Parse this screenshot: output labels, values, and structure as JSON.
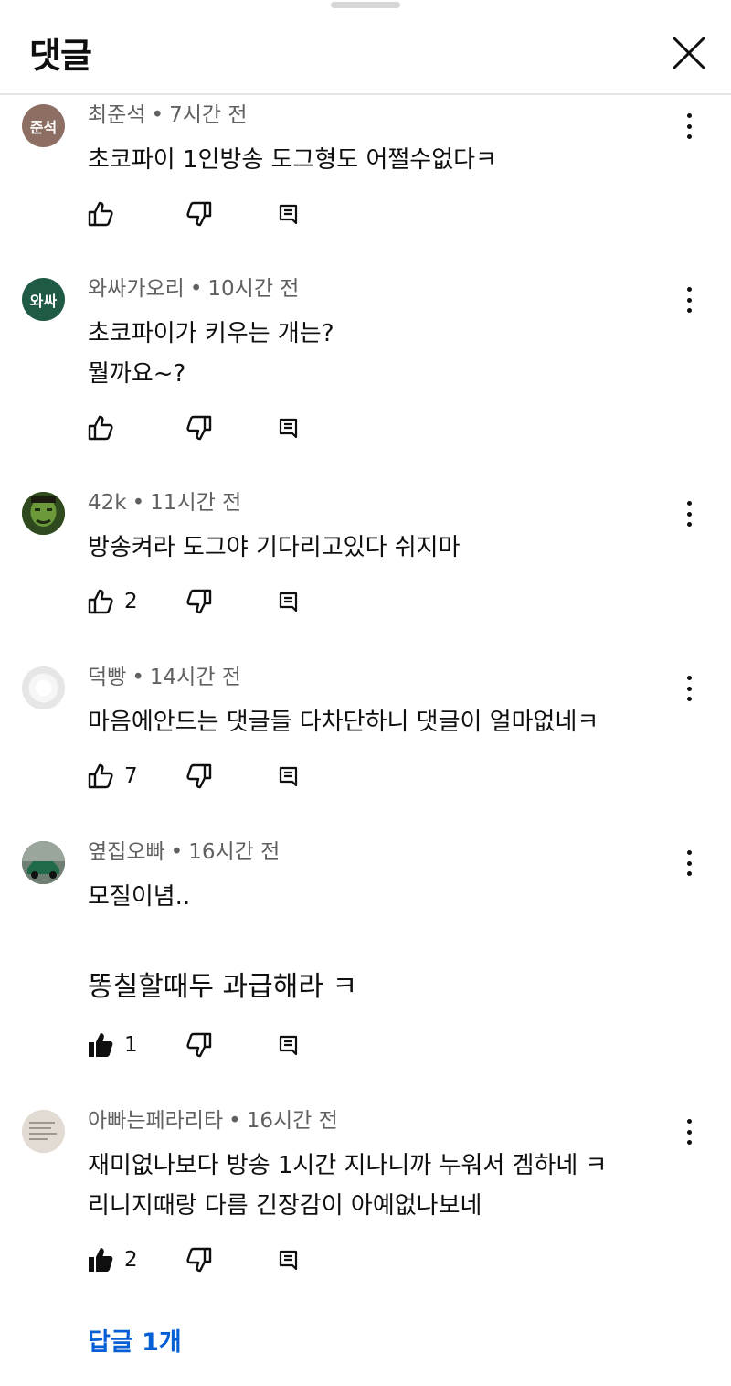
{
  "header": {
    "title": "댓글"
  },
  "comments": [
    {
      "avatar_text": "준석",
      "avatar_color": "#8d6e63",
      "author": "최준석",
      "time": "7시간 전",
      "lines": [
        "초코파이 1인방송 도그형도 어쩔수없다ㅋ"
      ],
      "likes": "",
      "liked": false
    },
    {
      "avatar_text": "와싸",
      "avatar_color": "#1f5a45",
      "author": "와싸가오리",
      "time": "10시간 전",
      "lines": [
        "초코파이가 키우는 개는?",
        "뭘까요~?"
      ],
      "likes": "",
      "liked": false
    },
    {
      "avatar_text": "",
      "avatar_color": "#4e7a2e",
      "author": "42k",
      "time": "11시간 전",
      "lines": [
        "방송켜라 도그야 기다리고있다 쉬지마"
      ],
      "likes": "2",
      "liked": false
    },
    {
      "avatar_text": "",
      "avatar_color": "#e4e4e4",
      "author": "덕빵",
      "time": "14시간 전",
      "lines": [
        "마음에안드는 댓글들 다차단하니 댓글이 얼마없네ㅋ"
      ],
      "likes": "7",
      "liked": false
    },
    {
      "avatar_text": "",
      "avatar_color": "#3f5b4a",
      "author": "옆집오빠",
      "time": "16시간 전",
      "lines": [
        "모질이념..",
        "똥칠할때두 과급해라 ㅋ"
      ],
      "likes": "1",
      "liked": true
    },
    {
      "avatar_text": "",
      "avatar_color": "#ddd6cf",
      "author": "아빠는페라리타",
      "time": "16시간 전",
      "lines": [
        "재미없나보다 방송 1시간 지나니까 누워서 겜하네 ㅋ",
        "리니지때랑 다름 긴장감이 아예없나보네"
      ],
      "likes": "2",
      "liked": true
    }
  ],
  "replies_link": "답글 1개"
}
